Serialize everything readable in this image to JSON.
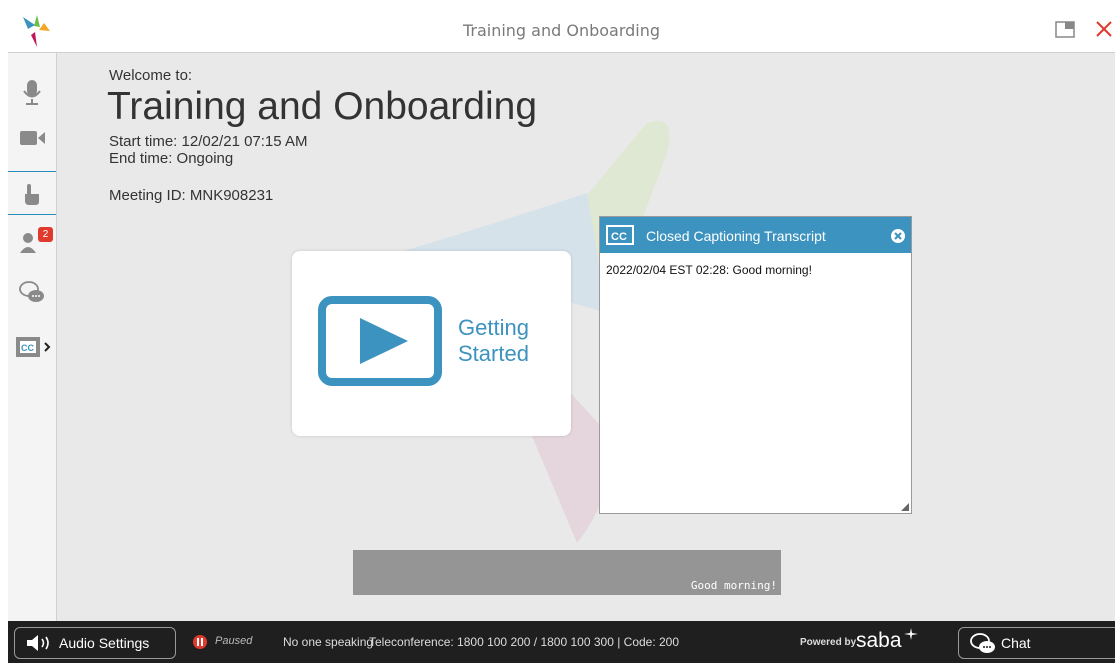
{
  "window": {
    "title": "Training and Onboarding"
  },
  "meeting": {
    "welcome": "Welcome to:",
    "title": "Training and Onboarding",
    "start_time": "Start time: 12/02/21 07:15 AM",
    "end_time": "End time: Ongoing",
    "meeting_id": "Meeting ID: MNK908231"
  },
  "sidebar": {
    "items": [
      {
        "icon": "microphone-icon"
      },
      {
        "icon": "camera-icon"
      },
      {
        "icon": "raise-hand-icon"
      },
      {
        "icon": "participants-icon",
        "badge": "2"
      },
      {
        "icon": "chat-bubbles-icon"
      },
      {
        "icon": "closed-captions-icon",
        "selected": true
      }
    ]
  },
  "card": {
    "label_line1": "Getting",
    "label_line2": "Started"
  },
  "cc_panel": {
    "title": "Closed Captioning Transcript",
    "lines": [
      "2022/02/04 EST 02:28: Good morning!"
    ]
  },
  "caption_bar": {
    "text": "Good morning!"
  },
  "statusbar": {
    "audio_settings": "Audio Settings",
    "paused": "Paused",
    "speaking": "No one speaking",
    "teleconference": "Teleconference: 1800 100 200 / 1800 100 300 | Code: 200",
    "powered_by": "Powered by",
    "brand": "saba",
    "chat": "Chat"
  },
  "colors": {
    "accent": "#3d93bf",
    "badge": "#e03a2e",
    "statusbar": "#1f1f1f",
    "stage": "#e9e9e9"
  }
}
